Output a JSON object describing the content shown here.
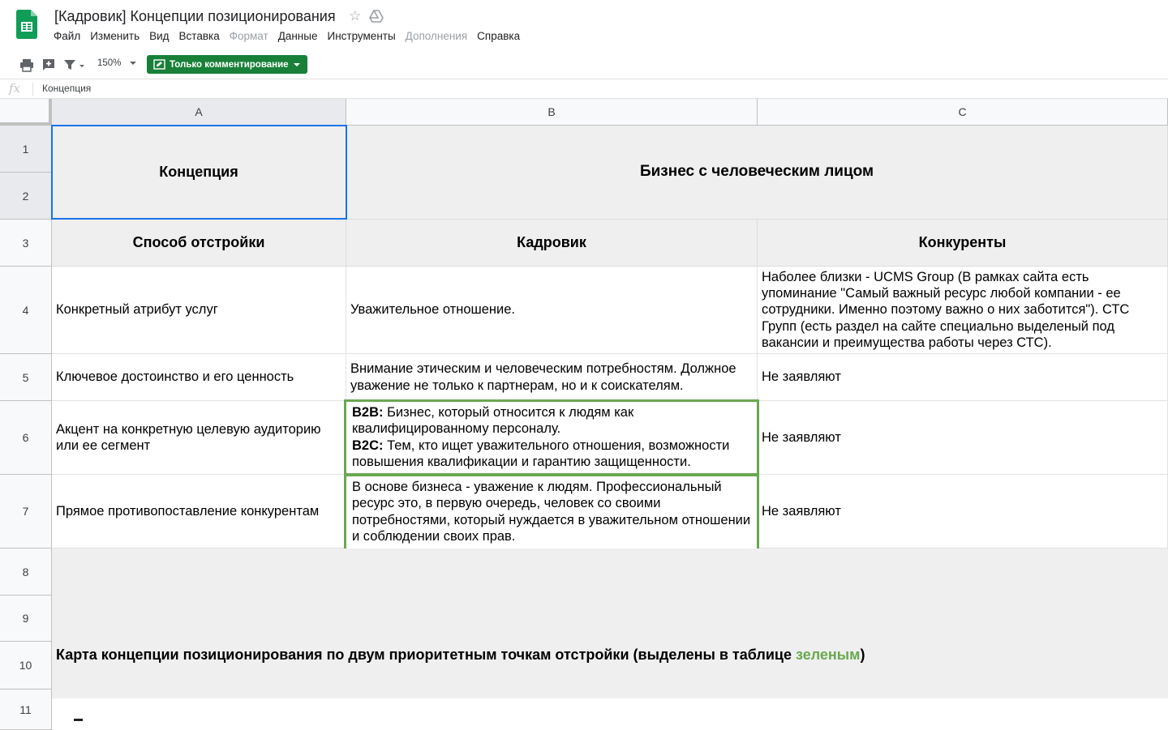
{
  "app": {
    "title": "[Кадровик] Концепции позиционирования",
    "brand_color": "#0f9d58",
    "star_icon": "☆"
  },
  "menu": [
    {
      "label": "Файл",
      "enabled": true
    },
    {
      "label": "Изменить",
      "enabled": true
    },
    {
      "label": "Вид",
      "enabled": true
    },
    {
      "label": "Вставка",
      "enabled": true
    },
    {
      "label": "Формат",
      "enabled": false
    },
    {
      "label": "Данные",
      "enabled": true
    },
    {
      "label": "Инструменты",
      "enabled": true
    },
    {
      "label": "Дополнения",
      "enabled": false
    },
    {
      "label": "Справка",
      "enabled": true
    }
  ],
  "toolbar": {
    "zoom": "150%",
    "mode_label": "Только комментирование",
    "mode_color": "#188038",
    "icons": [
      "print-icon",
      "add-comment-icon",
      "filter-icon"
    ]
  },
  "formula_bar": {
    "fx": "fx",
    "value": "Концепция"
  },
  "columns": [
    "A",
    "B",
    "C"
  ],
  "rows": [
    "1",
    "2",
    "3",
    "4",
    "5",
    "6",
    "7",
    "8",
    "9",
    "10",
    "11"
  ],
  "cells": {
    "a1": "Концепция",
    "b1": "Бизнес с человеческим лицом",
    "a3": "Способ отстройки",
    "b3": "Кадровик",
    "c3": "Конкуренты",
    "a4": "Конкретный атрибут услуг",
    "b4": "Уважительное отношение.",
    "c4": "Наболее близки - UCMS Group (В рамках сайта есть упоминание \"Самый важный ресурс любой компании - ее сотрудники. Именно поэтому важно о них заботится\"). СТС Групп (есть раздел на сайте специально выделеный под вакансии и преимущества работы через СТС).",
    "a5": "Ключевое достоинство и его ценность",
    "b5": "Внимание этическим и человеческим потребностям. Должное уважение не только к партнерам, но и к соискателям.",
    "c5": "Не заявляют",
    "a6": "Акцент на конкретную целевую аудиторию или ее сегмент",
    "b6_b2b_label": "B2B:",
    "b6_b2b_text": " Бизнес, который относится к людям как квалифицированному персоналу.",
    "b6_b2c_label": "B2C:",
    "b6_b2c_text": " Тем, кто ищет уважительного отношения, возможности повышения квалификации и гарантию защищенности.",
    "c6": "Не заявляют",
    "a7": "Прямое противопоставление конкурентам",
    "b7": "В основе бизнеса - уважение к людям. Профессиональный ресурс это, в первую очередь, человек со своими потребностями, который нуждается в уважительном отношении и соблюдении своих прав.",
    "c7": "Не заявляют",
    "a10_main": "Карта концепции позиционирования по двум приоритетным точкам отстройки (выделены в таблице ",
    "a10_green": "зеленым",
    "a10_end": ")"
  },
  "colors": {
    "selection": "#1a73e8",
    "highlight_green": "#6aa84f",
    "header_fill": "#efefef"
  }
}
